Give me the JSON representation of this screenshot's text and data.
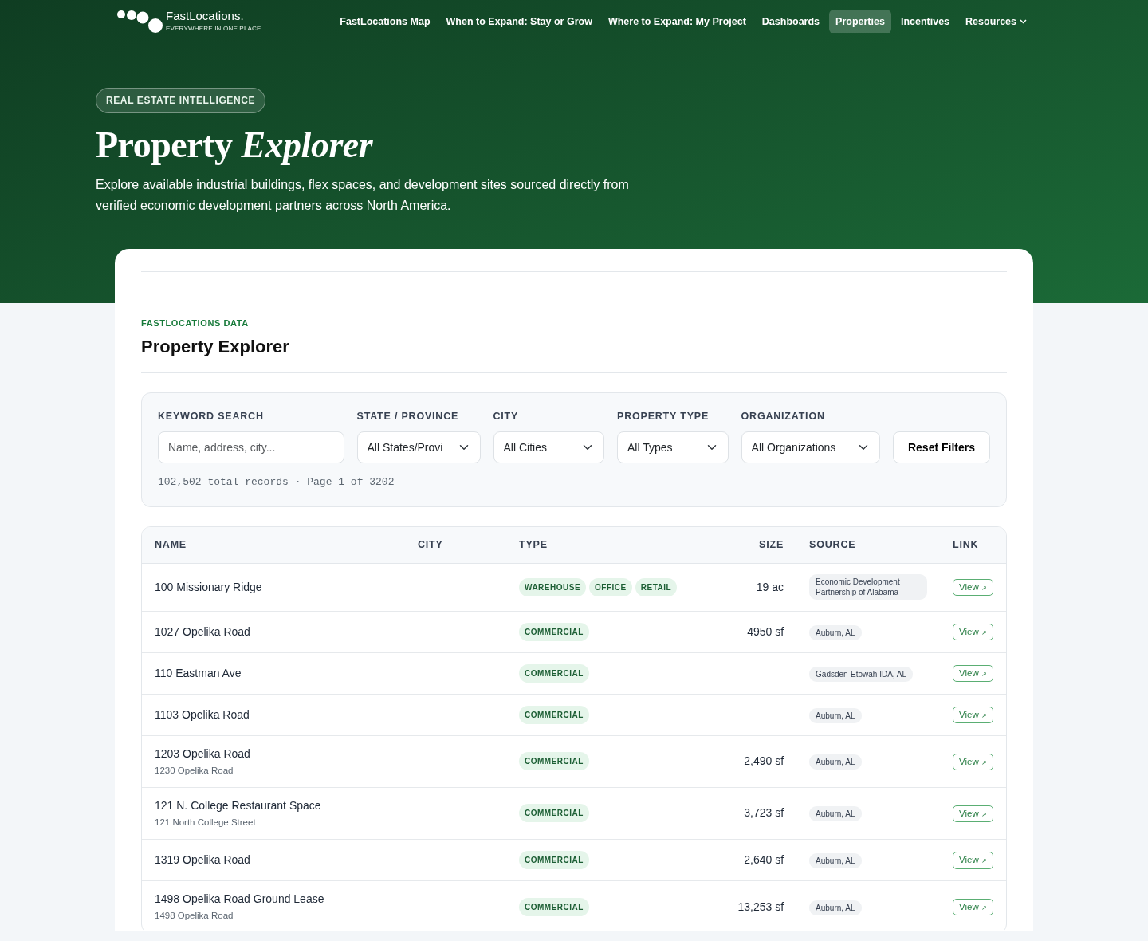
{
  "brand": {
    "name": "FastLocations.",
    "tagline": "EVERYWHERE IN ONE PLACE"
  },
  "nav": [
    {
      "label": "FastLocations Map",
      "selected": false,
      "dropdown": false
    },
    {
      "label": "When to Expand: Stay or Grow",
      "selected": false,
      "dropdown": false
    },
    {
      "label": "Where to Expand: My Project",
      "selected": false,
      "dropdown": false
    },
    {
      "label": "Dashboards",
      "selected": false,
      "dropdown": false
    },
    {
      "label": "Properties",
      "selected": true,
      "dropdown": false
    },
    {
      "label": "Incentives",
      "selected": false,
      "dropdown": false
    },
    {
      "label": "Resources",
      "selected": false,
      "dropdown": true
    }
  ],
  "hero": {
    "eyebrow": "REAL ESTATE INTELLIGENCE",
    "title": "Property *Explorer*",
    "lead": "Explore available industrial buildings, flex spaces, and development sites sourced directly from verified economic development partners across North America."
  },
  "section": {
    "eyebrow": "FASTLOCATIONS DATA",
    "title": "Property Explorer"
  },
  "filters": {
    "keyword": {
      "label": "KEYWORD SEARCH",
      "placeholder": "Name, address, city..."
    },
    "selects": [
      {
        "label": "STATE / PROVINCE",
        "value": "All States/Provi"
      },
      {
        "label": "CITY",
        "value": "All Cities"
      },
      {
        "label": "PROPERTY TYPE",
        "value": "All Types"
      },
      {
        "label": "ORGANIZATION",
        "value": "All Organizations"
      }
    ],
    "reset": "Reset Filters",
    "summary": "102,502 total records · Page 1 of 3202"
  },
  "table": {
    "columns": [
      "NAME",
      "CITY",
      "TYPE",
      "SIZE",
      "SOURCE",
      "LINK"
    ],
    "rows": [
      {
        "name": "100 Missionary Ridge",
        "types": [
          "WAREHOUSE",
          "OFFICE",
          "RETAIL"
        ],
        "size": "19 ac",
        "source": "Economic Development Partnership of Alabama",
        "link": "View",
        "link_icon": "↗"
      },
      {
        "name": "1027 Opelika Road",
        "types": [
          "COMMERCIAL"
        ],
        "size": "4950 sf",
        "source": "Auburn, AL",
        "link": "View",
        "link_icon": "↗"
      },
      {
        "name": "110 Eastman Ave",
        "types": [
          "COMMERCIAL"
        ],
        "source": "Gadsden-Etowah IDA, AL",
        "link": "View",
        "link_icon": "↗"
      },
      {
        "name": "1103 Opelika Road",
        "types": [
          "COMMERCIAL"
        ],
        "source": "Auburn, AL",
        "link": "View",
        "link_icon": "↗"
      },
      {
        "name": "1203 Opelika Road",
        "address": "1230 Opelika Road",
        "types": [
          "COMMERCIAL"
        ],
        "size": "2,490 sf",
        "source": "Auburn, AL",
        "link": "View",
        "link_icon": "↗"
      },
      {
        "name": "121 N. College Restaurant Space",
        "address": "121 North College Street",
        "types": [
          "COMMERCIAL"
        ],
        "size": "3,723 sf",
        "source": "Auburn, AL",
        "link": "View",
        "link_icon": "↗"
      },
      {
        "name": "1319 Opelika Road",
        "types": [
          "COMMERCIAL"
        ],
        "size": "2,640 sf",
        "source": "Auburn, AL",
        "link": "View",
        "link_icon": "↗"
      },
      {
        "name": "1498 Opelika Road Ground Lease",
        "address": "1498 Opelika Road",
        "types": [
          "COMMERCIAL"
        ],
        "size": "13,253 sf",
        "source": "Auburn, AL",
        "link": "View",
        "link_icon": "↗"
      }
    ]
  }
}
